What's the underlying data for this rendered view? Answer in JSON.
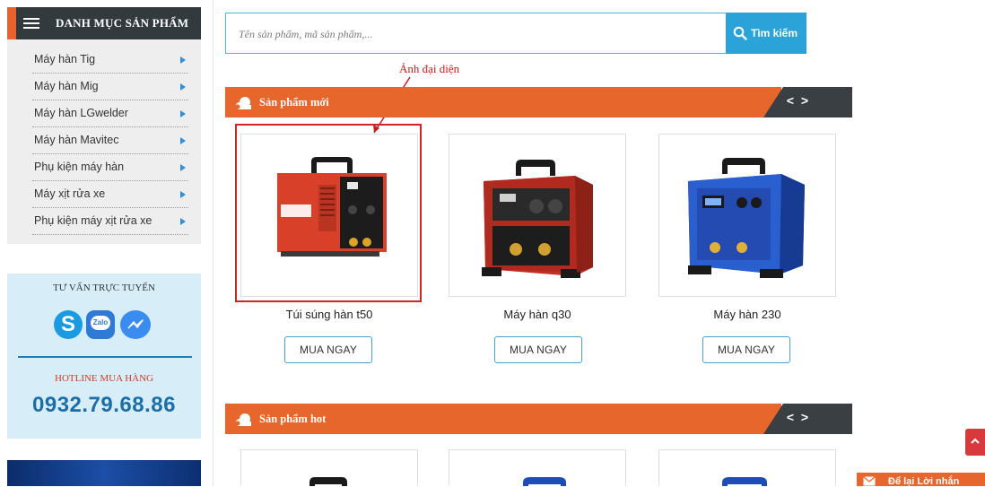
{
  "sidebar": {
    "category_title": "DANH MỤC SẢN PHẨM",
    "items": [
      {
        "label": "Máy hàn Tig"
      },
      {
        "label": "Máy hàn Mig"
      },
      {
        "label": "Máy hàn LGwelder"
      },
      {
        "label": "Máy hàn Mavitec"
      },
      {
        "label": "Phụ kiện máy hàn"
      },
      {
        "label": "Máy xịt rửa xe"
      },
      {
        "label": "Phụ kiện máy xịt rửa xe"
      }
    ],
    "advice_title": "TƯ VẤN TRỰC TUYẾN",
    "contact_icons": [
      "skype-icon",
      "zalo-icon",
      "messenger-icon"
    ],
    "zalo_text": "Zalo",
    "hotline_label": "HOTLINE MUA HÀNG",
    "hotline_number": "0932.79.68.86"
  },
  "search": {
    "placeholder": "Tên sản phẩm, mã sản phẩm,...",
    "value": "",
    "button_label": "Tìm kiếm"
  },
  "annotation": {
    "label": "Ảnh đại diện",
    "color": "#d0191b"
  },
  "sections": [
    {
      "title": "Sản phẩm mới",
      "prev_label": "<",
      "next_label": ">",
      "products": [
        {
          "name": "Túi súng hàn t50",
          "buy_label": "MUA NGAY"
        },
        {
          "name": "Máy hàn q30",
          "buy_label": "MUA NGAY"
        },
        {
          "name": "Máy hàn 230",
          "buy_label": "MUA NGAY"
        }
      ]
    },
    {
      "title": "Sản phẩm hot",
      "prev_label": "<",
      "next_label": ">"
    }
  ],
  "floating": {
    "leave_message_label": "Để lại Lời nhắn"
  },
  "colors": {
    "accent_orange": "#e7662c",
    "dark": "#3a3f43",
    "search_blue": "#2ba3d9",
    "hotline_blue": "#1c6ea8"
  }
}
